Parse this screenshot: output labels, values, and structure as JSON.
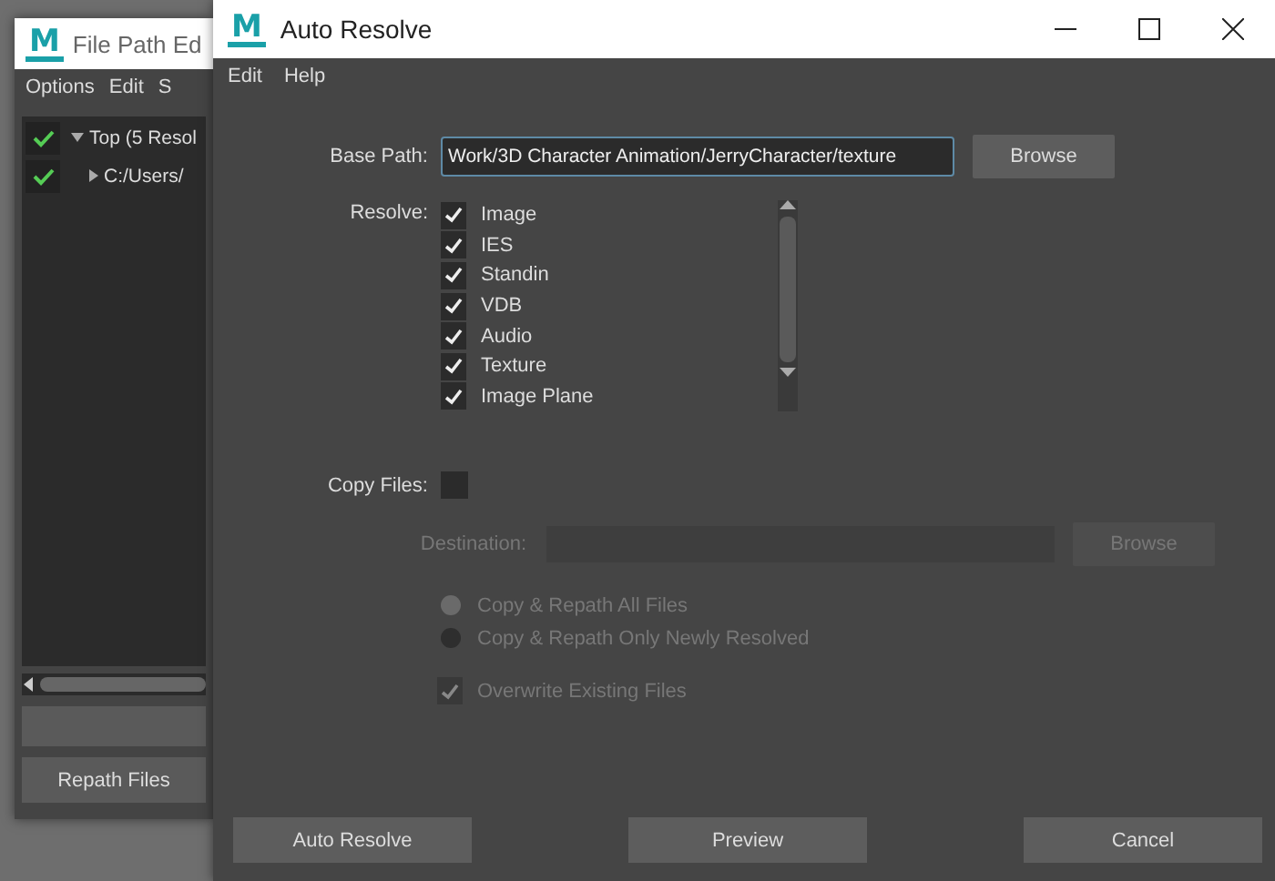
{
  "back_window": {
    "logo": "M",
    "title": "File Path Ed",
    "menu": [
      "Options",
      "Edit",
      "S"
    ],
    "tree": [
      {
        "label": "Top (5 Resol",
        "expanded": true,
        "children": [
          {
            "label": "C:/Users/",
            "expanded": false
          }
        ]
      }
    ],
    "buttons": [
      "Repath Files"
    ]
  },
  "window": {
    "logo": "M",
    "title": "Auto Resolve",
    "menu": [
      "Edit",
      "Help"
    ],
    "base_path": {
      "label": "Base Path:",
      "value": "Work/3D Character Animation/JerryCharacter/texture",
      "browse": "Browse"
    },
    "resolve": {
      "label": "Resolve:",
      "items": [
        {
          "label": "Image",
          "checked": true
        },
        {
          "label": "IES",
          "checked": true
        },
        {
          "label": "Standin",
          "checked": true
        },
        {
          "label": "VDB",
          "checked": true
        },
        {
          "label": "Audio",
          "checked": true
        },
        {
          "label": "Texture",
          "checked": true
        },
        {
          "label": "Image Plane",
          "checked": true
        }
      ]
    },
    "copy_files": {
      "label": "Copy Files:",
      "checked": false
    },
    "copy_options": {
      "disabled": true,
      "destination_label": "Destination:",
      "browse": "Browse",
      "radios": [
        {
          "label": "Copy & Repath All Files",
          "selected": true
        },
        {
          "label": "Copy & Repath Only Newly Resolved",
          "selected": false
        }
      ],
      "overwrite": {
        "label": "Overwrite Existing Files",
        "checked": true
      }
    },
    "buttons": [
      "Auto Resolve",
      "Preview",
      "Cancel"
    ]
  }
}
